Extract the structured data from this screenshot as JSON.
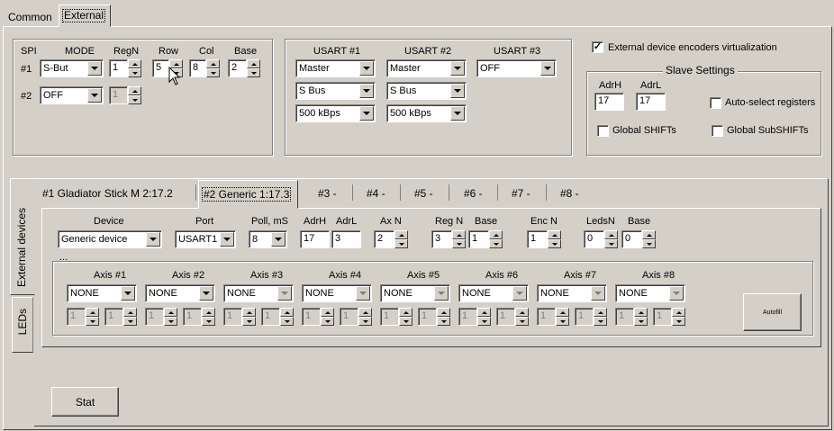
{
  "top_tabs": [
    "Common",
    "External"
  ],
  "spi": {
    "header": {
      "spi": "SPI",
      "mode": "MODE",
      "regn": "RegN",
      "row": "Row",
      "col": "Col",
      "base": "Base"
    },
    "row1": {
      "label": "#1",
      "mode": "S-But",
      "regn": "1",
      "row": "5",
      "col": "8",
      "base": "2"
    },
    "row2": {
      "label": "#2",
      "mode": "OFF",
      "regn": "1"
    }
  },
  "usart": {
    "headers": [
      "USART #1",
      "USART #2",
      "USART #3"
    ],
    "u1": [
      "Master",
      "S Bus",
      "500 kBps"
    ],
    "u2": [
      "Master",
      "S Bus",
      "500 kBps"
    ],
    "u3": [
      "OFF"
    ]
  },
  "virt": {
    "label": "External device encoders virtualization",
    "checked": "✓"
  },
  "slave": {
    "title": "Slave Settings",
    "adrh_label": "AdrH",
    "adrh": "17",
    "adrl_label": "AdrL",
    "adrl": "17",
    "auto_select": "Auto-select registers",
    "global_shifts": "Global SHIFTs",
    "global_subshifts": "Global SubSHIFTs"
  },
  "side_tabs": [
    "External devices",
    "LEDs"
  ],
  "device_tabs": [
    "#1 Gladiator Stick M 2:17.2",
    "#2 Generic 1:17.3",
    "#3 -",
    "#4 -",
    "#5 -",
    "#6 -",
    "#7 -",
    "#8 -"
  ],
  "device": {
    "labels": {
      "device": "Device",
      "port": "Port",
      "poll": "Poll, mS",
      "adrh": "AdrH",
      "adrl": "AdrL",
      "axn": "Ax N",
      "regn": "Reg N",
      "base": "Base",
      "encn": "Enc N",
      "ledsn": "LedsN",
      "base2": "Base"
    },
    "device": "Generic device",
    "port": "USART1",
    "poll": "8",
    "adrh": "17",
    "adrl": "3",
    "axn": "2",
    "regn": "3",
    "base": "1",
    "encn": "1",
    "ledsn": "0",
    "base2": "0",
    "ellipsis": "..."
  },
  "axes": [
    {
      "label": "Axis #1",
      "value": "NONE",
      "a": "1",
      "b": "1"
    },
    {
      "label": "Axis #2",
      "value": "NONE",
      "a": "1",
      "b": "1"
    },
    {
      "label": "Axis #3",
      "value": "NONE",
      "a": "1",
      "b": "1"
    },
    {
      "label": "Axis #4",
      "value": "NONE",
      "a": "1",
      "b": "1"
    },
    {
      "label": "Axis #5",
      "value": "NONE",
      "a": "1",
      "b": "1"
    },
    {
      "label": "Axis #6",
      "value": "NONE",
      "a": "1",
      "b": "1"
    },
    {
      "label": "Axis #7",
      "value": "NONE",
      "a": "1",
      "b": "1"
    },
    {
      "label": "Axis #8",
      "value": "NONE",
      "a": "1",
      "b": "1"
    }
  ],
  "autofill": "Autofill",
  "stat": "Stat"
}
